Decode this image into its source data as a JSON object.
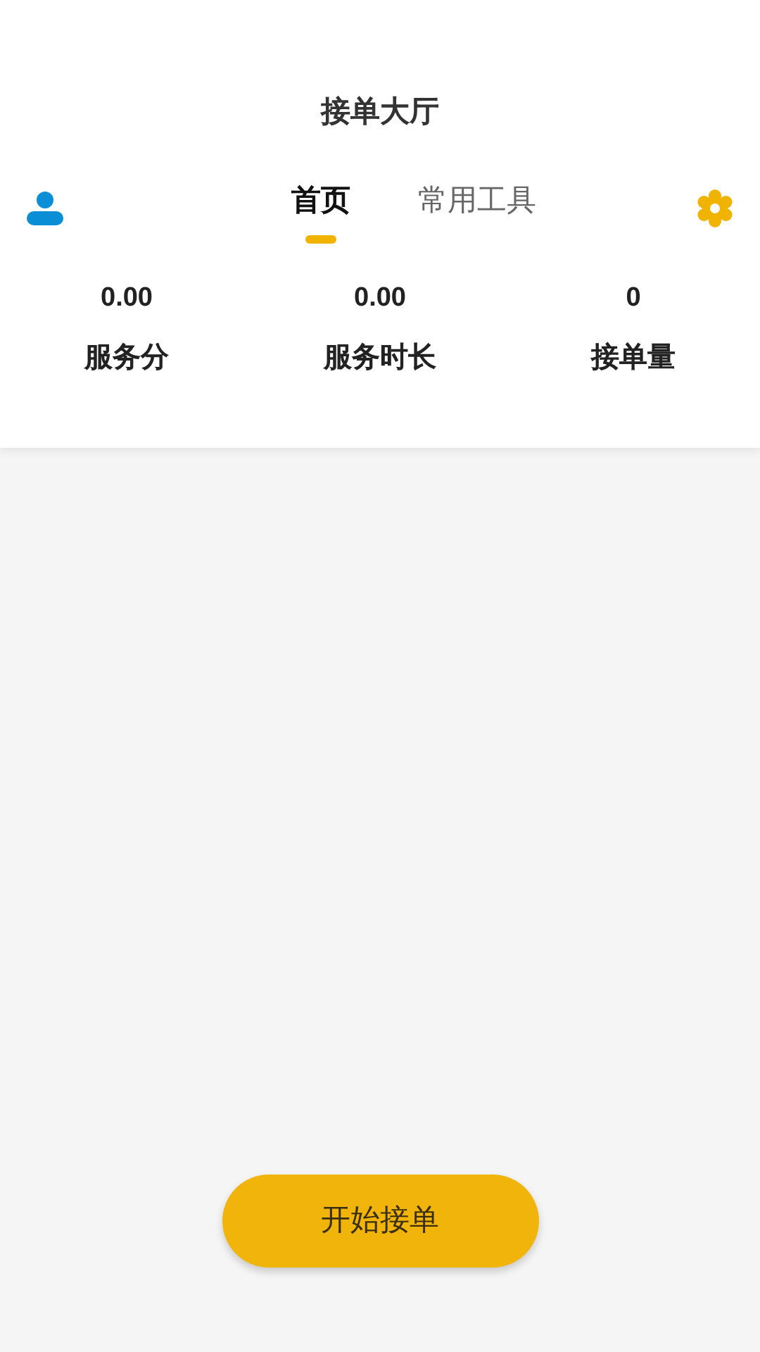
{
  "title": "接单大厅",
  "tabs": [
    {
      "label": "首页",
      "selected": true
    },
    {
      "label": "常用工具",
      "selected": false
    }
  ],
  "stats": [
    {
      "value": "0.00",
      "label": "服务分"
    },
    {
      "value": "0.00",
      "label": "服务时长"
    },
    {
      "value": "0",
      "label": "接单量"
    }
  ],
  "start_button": "开始接单"
}
